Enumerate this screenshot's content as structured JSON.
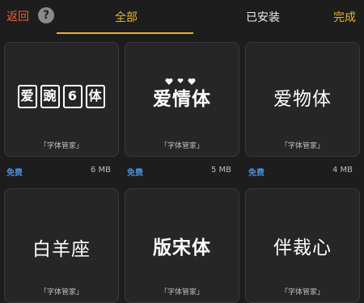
{
  "header": {
    "back_label": "返回",
    "help_icon": "?",
    "tabs": [
      {
        "label": "全部",
        "active": true
      },
      {
        "label": "已安装",
        "active": false
      }
    ],
    "done_label": "完成",
    "accent_color": "#e8b230",
    "back_color": "#f0603c"
  },
  "fonts": [
    {
      "name": "爱豌6体",
      "chars": [
        "爱",
        "豌",
        "6",
        "体"
      ],
      "caption": "「字体管家」",
      "price": "免费",
      "size": "6 MB"
    },
    {
      "name": "爱情体",
      "caption": "「字体管家」",
      "price": "免费",
      "size": "5 MB"
    },
    {
      "name": "爱物体",
      "caption": "「字体管家」",
      "price": "免费",
      "size": "4 MB"
    },
    {
      "name": "白羊座",
      "caption": "「字体管家」"
    },
    {
      "name": "版宋体",
      "caption": "「字体管家」"
    },
    {
      "name": "伴裁心",
      "caption": "「字体管家」"
    }
  ]
}
